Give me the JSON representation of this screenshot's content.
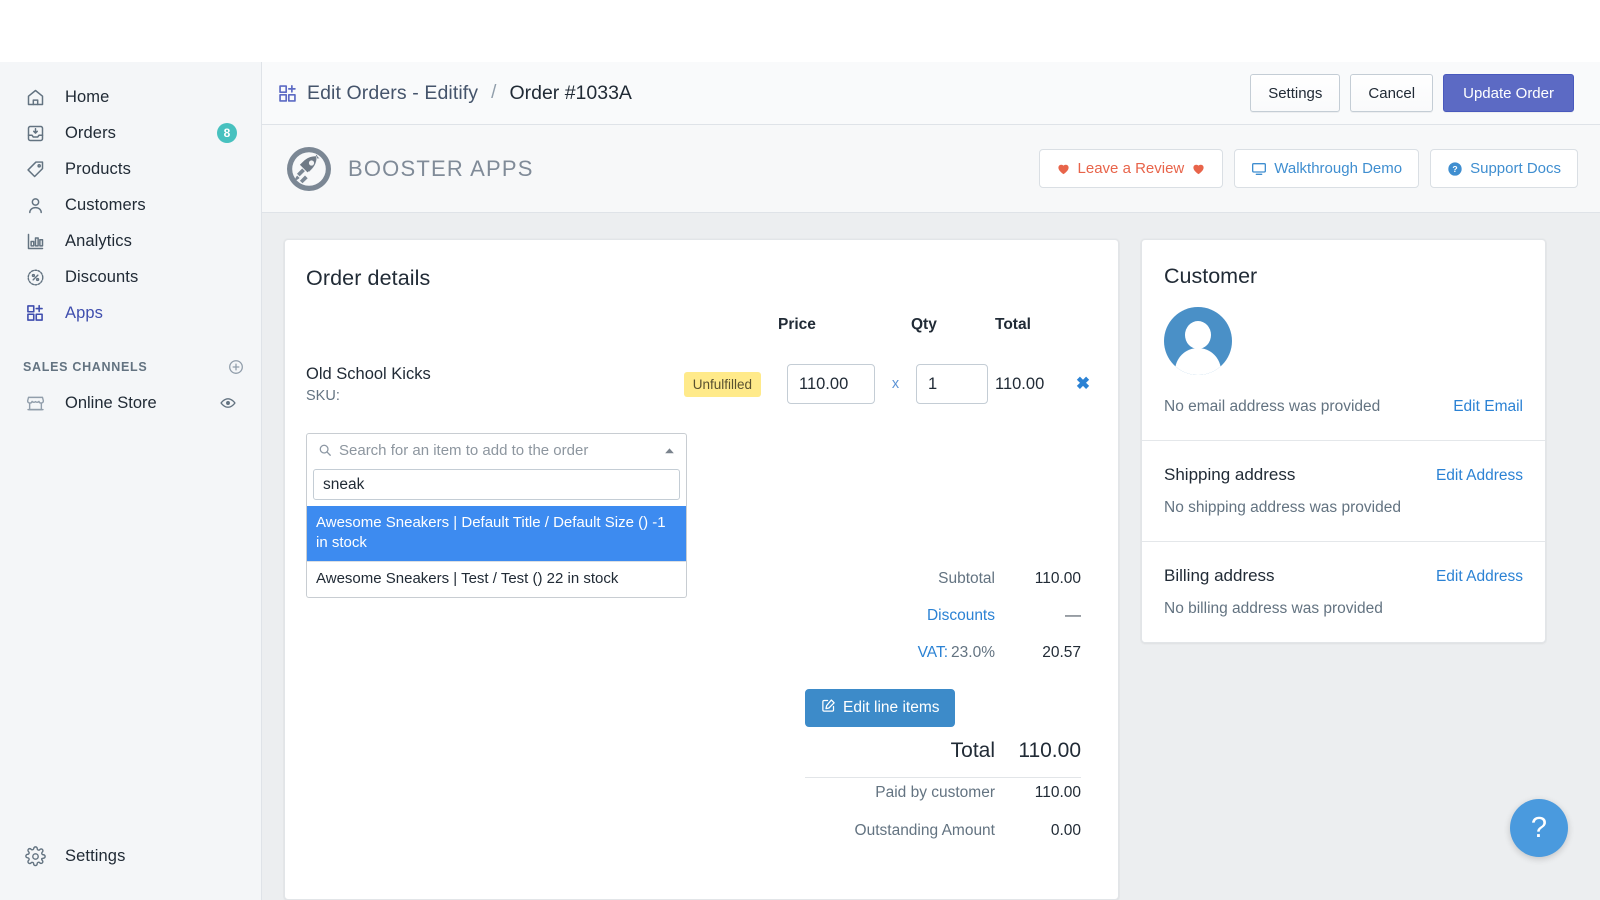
{
  "sidebar": {
    "nav": [
      {
        "label": "Home",
        "icon": "home-icon",
        "badge": null,
        "active": false
      },
      {
        "label": "Orders",
        "icon": "orders-inbox-icon",
        "badge": "8",
        "active": false
      },
      {
        "label": "Products",
        "icon": "tag-icon",
        "badge": null,
        "active": false
      },
      {
        "label": "Customers",
        "icon": "person-icon",
        "badge": null,
        "active": false
      },
      {
        "label": "Analytics",
        "icon": "bar-chart-icon",
        "badge": null,
        "active": false
      },
      {
        "label": "Discounts",
        "icon": "percent-badge-icon",
        "badge": null,
        "active": false
      },
      {
        "label": "Apps",
        "icon": "apps-grid-plus-icon",
        "badge": null,
        "active": true
      }
    ],
    "sales_channels_title": "SALES CHANNELS",
    "channels": [
      {
        "label": "Online Store",
        "icon": "storefront-icon",
        "trailing_icon": "eye-icon"
      }
    ],
    "settings_label": "Settings",
    "accent_active": "#3f4eae",
    "badge_color": "#47c1bf"
  },
  "topbar": {
    "app_name": "Edit Orders - Editify",
    "separator": "/",
    "current": "Order #1033A",
    "buttons": [
      {
        "label": "Settings",
        "style": "default"
      },
      {
        "label": "Cancel",
        "style": "default"
      },
      {
        "label": "Update Order",
        "style": "primary"
      }
    ],
    "primary_color": "#5c6ac4"
  },
  "booster": {
    "brand": "BOOSTER APPS",
    "actions": [
      {
        "label": "Leave a Review",
        "icon": "heart-icon",
        "trailing_icon": "heart-icon",
        "color": "#e8644a"
      },
      {
        "label": "Walkthrough Demo",
        "icon": "monitor-icon",
        "color": "#3f8ed0"
      },
      {
        "label": "Support Docs",
        "icon": "question-circle-icon",
        "color": "#3f8ed0"
      }
    ]
  },
  "order": {
    "title": "Order details",
    "columns": {
      "price": "Price",
      "qty": "Qty",
      "total": "Total"
    },
    "line_items": [
      {
        "name": "Old School Kicks",
        "sku_label": "SKU:",
        "status": "Unfulfilled",
        "price": "110.00",
        "multiply": "x",
        "qty": "1",
        "total": "110.00",
        "remove": "✖"
      }
    ],
    "search": {
      "placeholder": "Search for an item to add to the order",
      "query": "sneak",
      "options": [
        {
          "label": "Awesome Sneakers | Default Title / Default Size () -1 in stock",
          "selected": true
        },
        {
          "label": "Awesome Sneakers | Test / Test () 22 in stock",
          "selected": false
        }
      ],
      "highlight_color": "#3d8bf0"
    },
    "totals": {
      "subtotal_label": "Subtotal",
      "subtotal_value": "110.00",
      "discounts_label": "Discounts",
      "discounts_value": "—",
      "vat_label": "VAT:",
      "vat_rate": "23.0%",
      "vat_value": "20.57",
      "edit_line_items_label": "Edit line items",
      "grand_total_label": "Total",
      "grand_total_value": "110.00",
      "paid_label": "Paid by customer",
      "paid_value": "110.00",
      "outstanding_label": "Outstanding Amount",
      "outstanding_value": "0.00"
    }
  },
  "customer": {
    "title": "Customer",
    "email_text": "No email address was provided",
    "edit_email_label": "Edit Email",
    "shipping_title": "Shipping address",
    "shipping_edit_label": "Edit Address",
    "shipping_text": "No shipping address was provided",
    "billing_title": "Billing address",
    "billing_edit_label": "Edit Address",
    "billing_text": "No billing address was provided"
  },
  "help": {
    "glyph": "?",
    "color": "#4a9ade"
  }
}
